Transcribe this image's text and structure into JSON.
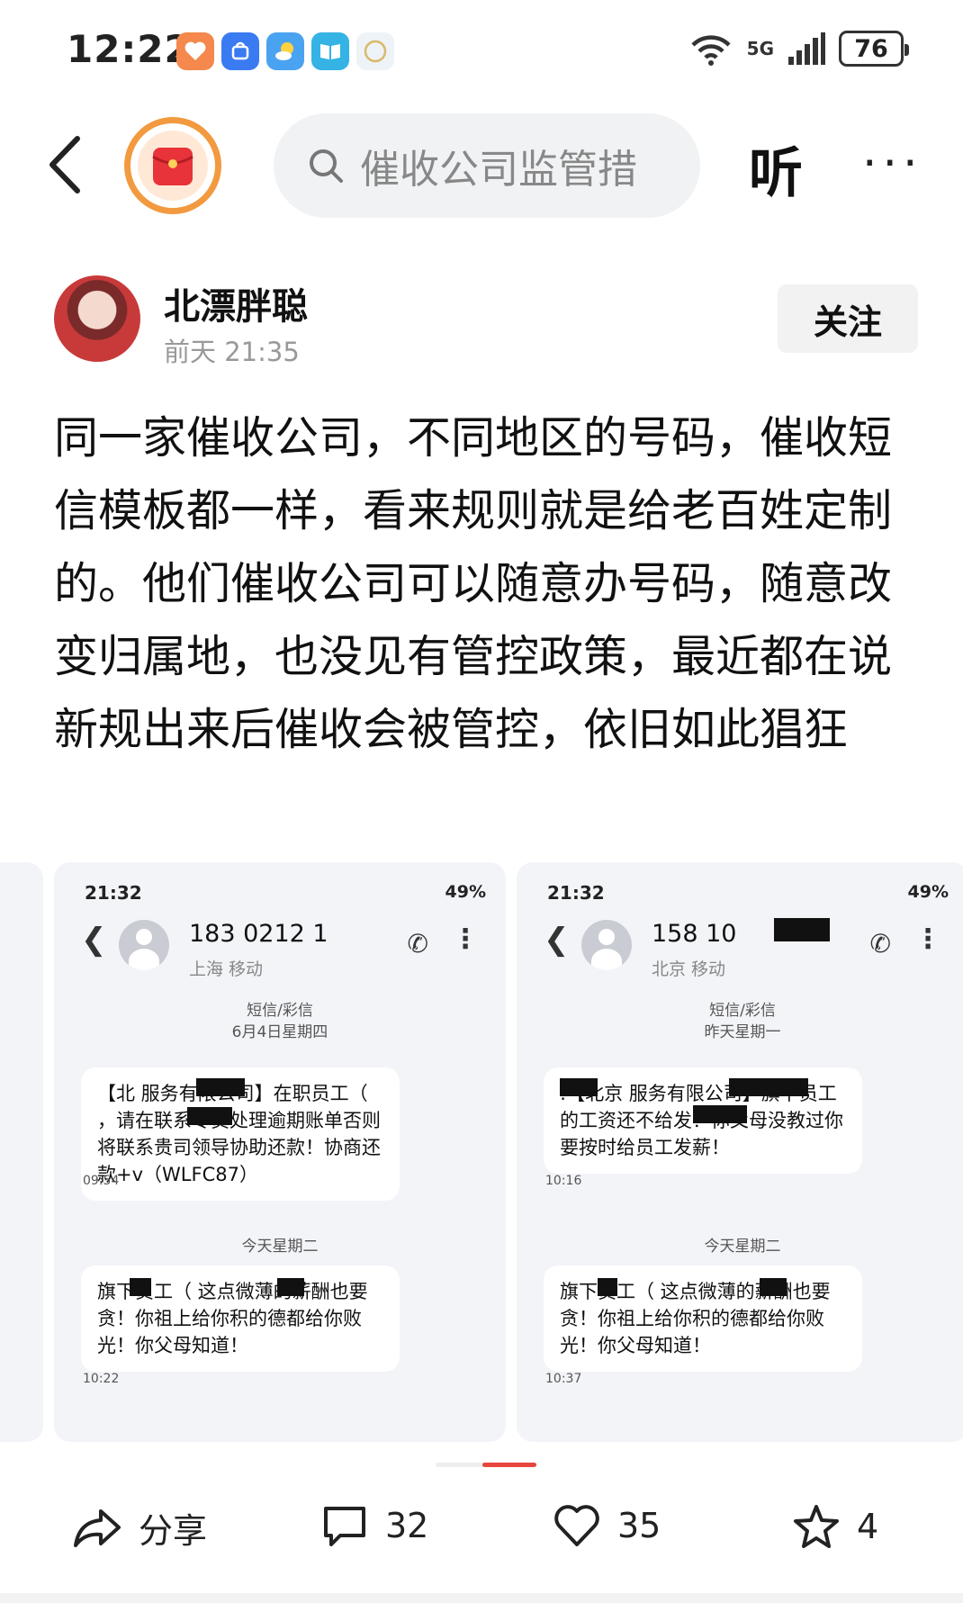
{
  "status_bar": {
    "time": "12:22",
    "battery": "76",
    "network_label": "5G"
  },
  "nav": {
    "search_placeholder": "催收公司监管措",
    "listen_label": "听",
    "more_label": "···"
  },
  "author": {
    "name": "北漂胖聪",
    "time": "前天  21:35",
    "follow_label": "关注"
  },
  "post": {
    "text": "同一家催收公司，不同地区的号码，催收短信模板都一样，看来规则就是给老百姓定制的。他们催收公司可以随意办号码，随意改变归属地，也没见有管控政策，最近都在说新规出来后催收会被管控，依旧如此猖狂"
  },
  "screenshots": [
    {
      "time": "21:32",
      "battery": "49%",
      "number": "183 0212 1",
      "location": "上海 移动",
      "kind": "短信/彩信",
      "date": "6月4日星期四",
      "msg1": "【北       服务有限公司】在职员工（      ，请在联系专员处理逾期账单否则将联系贵司领导协助还款！协商还款+v（WLFC87）",
      "msg1_time": "09:54",
      "today": "今天星期二",
      "msg2": "       旗下员工（      这点微薄的薪酬也要贪！你祖上给你积的德都给你败光！你父母知道！",
      "msg2_time": "10:22"
    },
    {
      "time": "21:32",
      "battery": "49%",
      "number": "158 10",
      "location": "北京 移动",
      "kind": "短信/彩信",
      "date": "昨天星期一",
      "msg1": "     :【北京       服务有限公司】旗下员工          的工资还不给发！你父母没教过你要按时给员工发薪！",
      "msg1_time": "10:16",
      "today": "今天星期二",
      "msg2": "       旗下员工（        这点微薄的薪酬也要贪！你祖上给你积的德都给你败光！你父母知道！",
      "msg2_time": "10:37"
    }
  ],
  "actions": {
    "share_label": "分享",
    "comments": "32",
    "likes": "35",
    "favorites": "4"
  },
  "colors": {
    "accent": "#e8453c",
    "brand_ring": "#f29a3f"
  }
}
